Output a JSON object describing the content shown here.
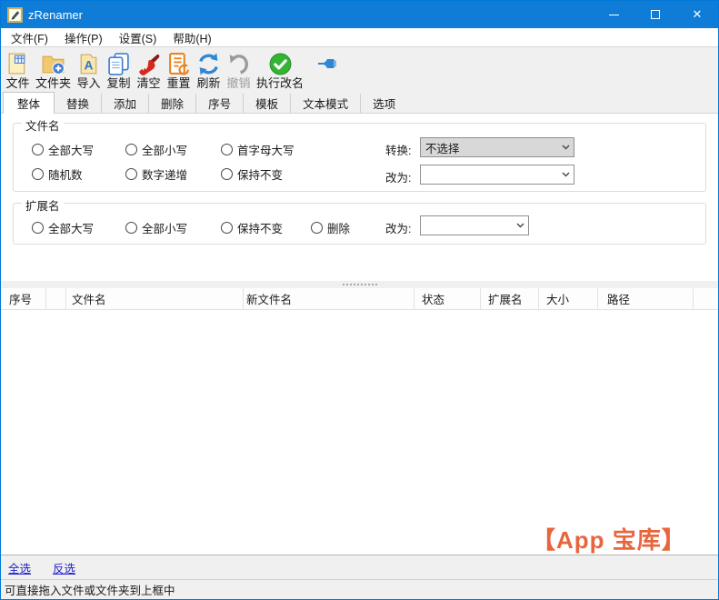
{
  "window": {
    "title": "zRenamer"
  },
  "titlebar": {
    "close_glyph": "✕"
  },
  "menu": {
    "items": [
      "文件(F)",
      "操作(P)",
      "设置(S)",
      "帮助(H)"
    ]
  },
  "toolbar": {
    "buttons": [
      {
        "label": "文件"
      },
      {
        "label": "文件夹"
      },
      {
        "label": "导入"
      },
      {
        "label": "复制"
      },
      {
        "label": "清空"
      },
      {
        "label": "重置"
      },
      {
        "label": "刷新"
      },
      {
        "label": "撤销",
        "disabled": true
      },
      {
        "label": "执行改名"
      }
    ]
  },
  "tabs": {
    "items": [
      "整体",
      "替换",
      "添加",
      "删除",
      "序号",
      "模板",
      "文本模式",
      "选项"
    ],
    "active": "整体"
  },
  "filename_group": {
    "title": "文件名",
    "radios": [
      "全部大写",
      "全部小写",
      "首字母大写",
      "随机数",
      "数字递增",
      "保持不变"
    ],
    "convert_label": "转换:",
    "convert_value": "不选择",
    "change_label": "改为:",
    "change_value": ""
  },
  "extension_group": {
    "title": "扩展名",
    "radios": [
      "全部大写",
      "全部小写",
      "保持不变",
      "删除"
    ],
    "change_label": "改为:",
    "change_value": ""
  },
  "file_table": {
    "columns": [
      "序号",
      "",
      "文件名",
      "新文件名",
      "状态",
      "扩展名",
      "大小",
      "路径"
    ],
    "rows": []
  },
  "watermark": {
    "text": "【App 宝库】",
    "color": "#e8653e"
  },
  "selection_bar": {
    "select_all": "全选",
    "invert": "反选"
  },
  "status_bar": {
    "text": "可直接拖入文件或文件夹到上框中"
  },
  "colors": {
    "titlebar": "#0f7cd7",
    "accent_green": "#35b335",
    "accent_red": "#d42a1e",
    "accent_blue": "#2f86d2",
    "accent_orange": "#e8821e"
  }
}
